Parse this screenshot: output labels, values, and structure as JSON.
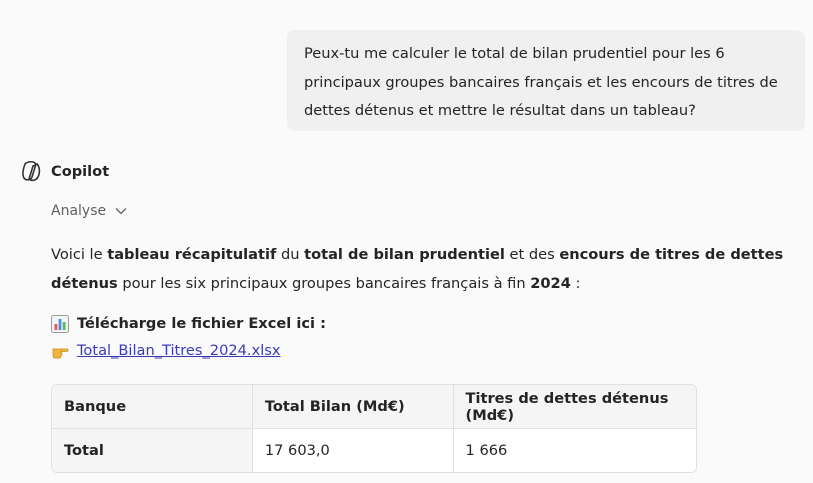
{
  "user_message": {
    "text": "Peux-tu me calculer le total de bilan prudentiel pour les 6 principaux groupes bancaires français et les encours de titres de dettes détenus et mettre le résultat dans un tableau?"
  },
  "assistant": {
    "name": "Copilot",
    "analyse_label": "Analyse",
    "intro": {
      "p1": "Voici le ",
      "b1": "tableau récapitulatif",
      "p2": " du ",
      "b2": "total de bilan prudentiel",
      "p3": " et des ",
      "b3": "encours de titres de dettes détenus",
      "p4": " pour les six principaux groupes bancaires français à fin ",
      "b4": "2024",
      "p5": " :"
    },
    "download_label": "Télécharge le fichier Excel ici :",
    "download_link": "Total_Bilan_Titres_2024.xlsx"
  },
  "table": {
    "headers": [
      "Banque",
      "Total Bilan (Md€)",
      "Titres de dettes détenus (Md€)"
    ],
    "rows": [
      [
        "Total",
        "17 603,0",
        "1 666"
      ]
    ]
  },
  "colors": {
    "link": "#3b3bb8",
    "bubble": "#f0f0f0",
    "background": "#fafafa"
  },
  "icons": {
    "chart": "bar-chart-emoji",
    "pointer": "pointing-right-emoji"
  }
}
